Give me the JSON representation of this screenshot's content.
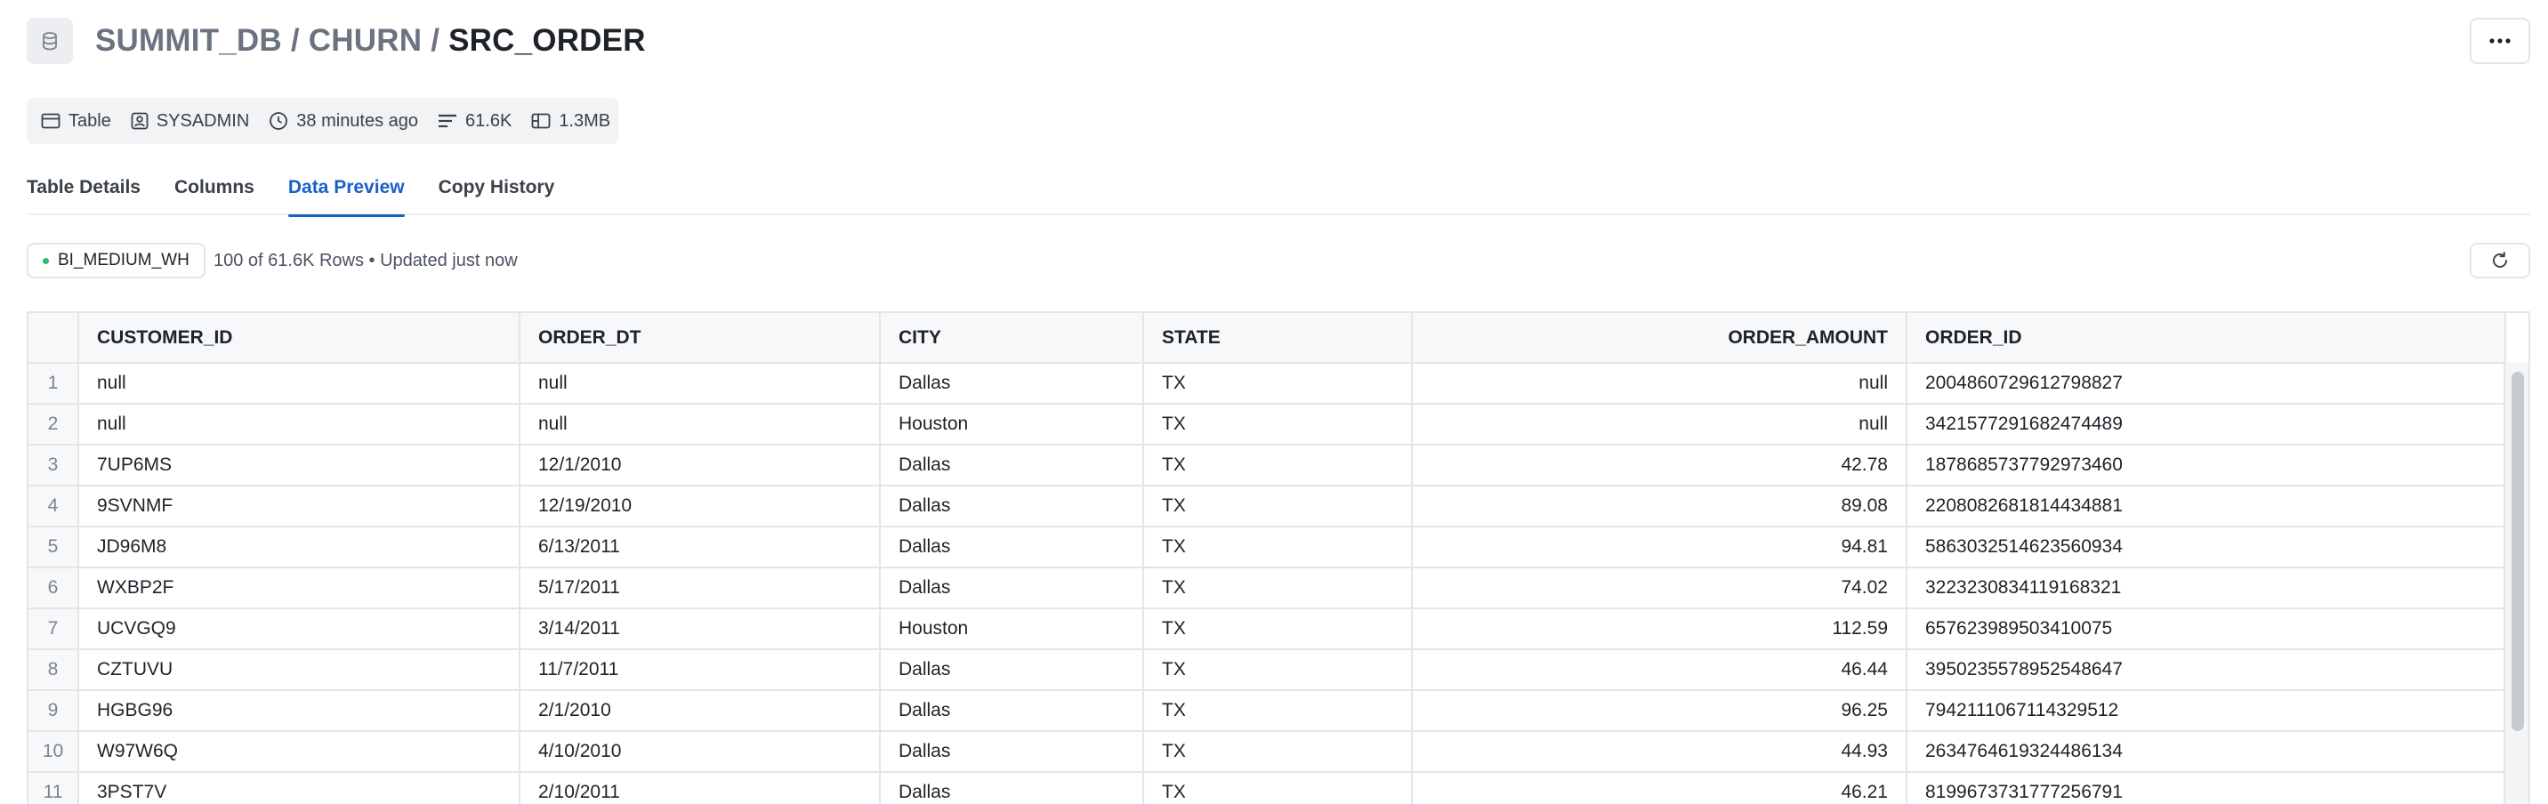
{
  "breadcrumb": {
    "database": "SUMMIT_DB",
    "schema": "CHURN",
    "table": "SRC_ORDER",
    "separator": "/"
  },
  "meta": {
    "type": "Table",
    "owner": "SYSADMIN",
    "updated": "38 minutes ago",
    "rows": "61.6K",
    "size": "1.3MB"
  },
  "tabs": [
    {
      "label": "Table Details"
    },
    {
      "label": "Columns"
    },
    {
      "label": "Data Preview",
      "active": true
    },
    {
      "label": "Copy History"
    }
  ],
  "toolbar": {
    "warehouse": "BI_MEDIUM_WH",
    "rows_info": "100 of 61.6K Rows • Updated just now"
  },
  "table": {
    "columns": [
      "CUSTOMER_ID",
      "ORDER_DT",
      "CITY",
      "STATE",
      "ORDER_AMOUNT",
      "ORDER_ID"
    ],
    "rows": [
      {
        "n": "1",
        "cells": [
          "null",
          "null",
          "Dallas",
          "TX",
          "null",
          "2004860729612798827"
        ]
      },
      {
        "n": "2",
        "cells": [
          "null",
          "null",
          "Houston",
          "TX",
          "null",
          "3421577291682474489"
        ]
      },
      {
        "n": "3",
        "cells": [
          "7UP6MS",
          "12/1/2010",
          "Dallas",
          "TX",
          "42.78",
          "1878685737792973460"
        ]
      },
      {
        "n": "4",
        "cells": [
          "9SVNMF",
          "12/19/2010",
          "Dallas",
          "TX",
          "89.08",
          "2208082681814434881"
        ]
      },
      {
        "n": "5",
        "cells": [
          "JD96M8",
          "6/13/2011",
          "Dallas",
          "TX",
          "94.81",
          "5863032514623560934"
        ]
      },
      {
        "n": "6",
        "cells": [
          "WXBP2F",
          "5/17/2011",
          "Dallas",
          "TX",
          "74.02",
          "3223230834119168321"
        ]
      },
      {
        "n": "7",
        "cells": [
          "UCVGQ9",
          "3/14/2011",
          "Houston",
          "TX",
          "112.59",
          "657623989503410075"
        ]
      },
      {
        "n": "8",
        "cells": [
          "CZTUVU",
          "11/7/2011",
          "Dallas",
          "TX",
          "46.44",
          "3950235578952548647"
        ]
      },
      {
        "n": "9",
        "cells": [
          "HGBG96",
          "2/1/2010",
          "Dallas",
          "TX",
          "96.25",
          "7942111067114329512"
        ]
      },
      {
        "n": "10",
        "cells": [
          "W97W6Q",
          "4/10/2010",
          "Dallas",
          "TX",
          "44.93",
          "2634764619324486134"
        ]
      },
      {
        "n": "11",
        "cells": [
          "3PST7V",
          "2/10/2011",
          "Dallas",
          "TX",
          "46.21",
          "8199673731777256791"
        ]
      }
    ]
  },
  "icons": {
    "database": "database-icon",
    "more": "more-horizontal-icon",
    "table": "table-icon",
    "owner": "user-badge-icon",
    "clock": "clock-icon",
    "rows": "rows-icon",
    "size": "storage-icon",
    "refresh": "refresh-icon"
  },
  "colors": {
    "accent": "#1a5fc8",
    "warehouse_status": "#2eb872"
  }
}
